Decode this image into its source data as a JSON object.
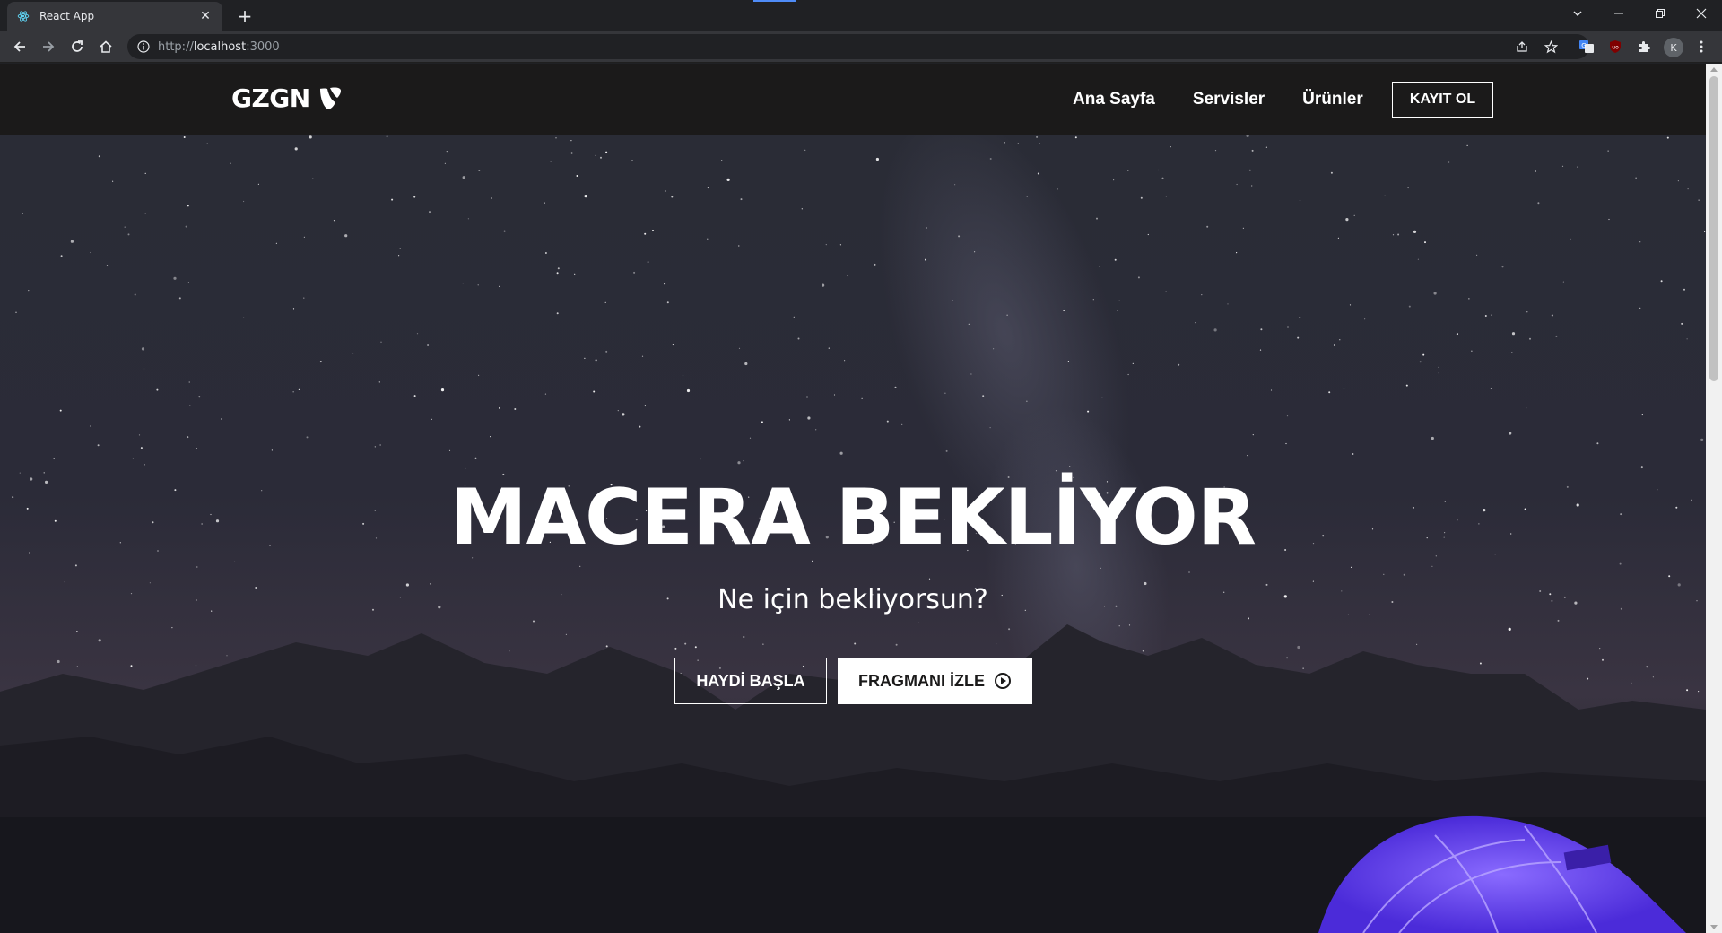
{
  "browser": {
    "tab_title": "React App",
    "tab_favicon": "react-icon",
    "new_tab": "+",
    "url_scheme": "http://",
    "url_host": "localhost",
    "url_port": ":3000",
    "profile_initial": "K",
    "icons": [
      "back-icon",
      "forward-icon",
      "reload-icon",
      "home-icon",
      "info-icon",
      "share-icon",
      "star-icon",
      "translate-icon",
      "ublock-icon",
      "extensions-icon",
      "menu-icon"
    ]
  },
  "site": {
    "logo_text": "GZGN",
    "logo_icon": "typo3-icon",
    "nav": {
      "items": [
        "Ana Sayfa",
        "Servisler",
        "Ürünler"
      ],
      "signup": "KAYIT OL"
    },
    "hero": {
      "title": "MACERA BEKLİYOR",
      "subtitle": "Ne için bekliyorsun?",
      "primary_button": "HAYDİ BAŞLA",
      "secondary_button": "FRAGMANI İZLE",
      "secondary_icon": "play-circle-icon"
    }
  },
  "colors": {
    "navbar_bg": "#1b1a1a",
    "sky_top": "#2a2c36",
    "mountains": "#1c1b22",
    "tent": "#6b3df2"
  }
}
